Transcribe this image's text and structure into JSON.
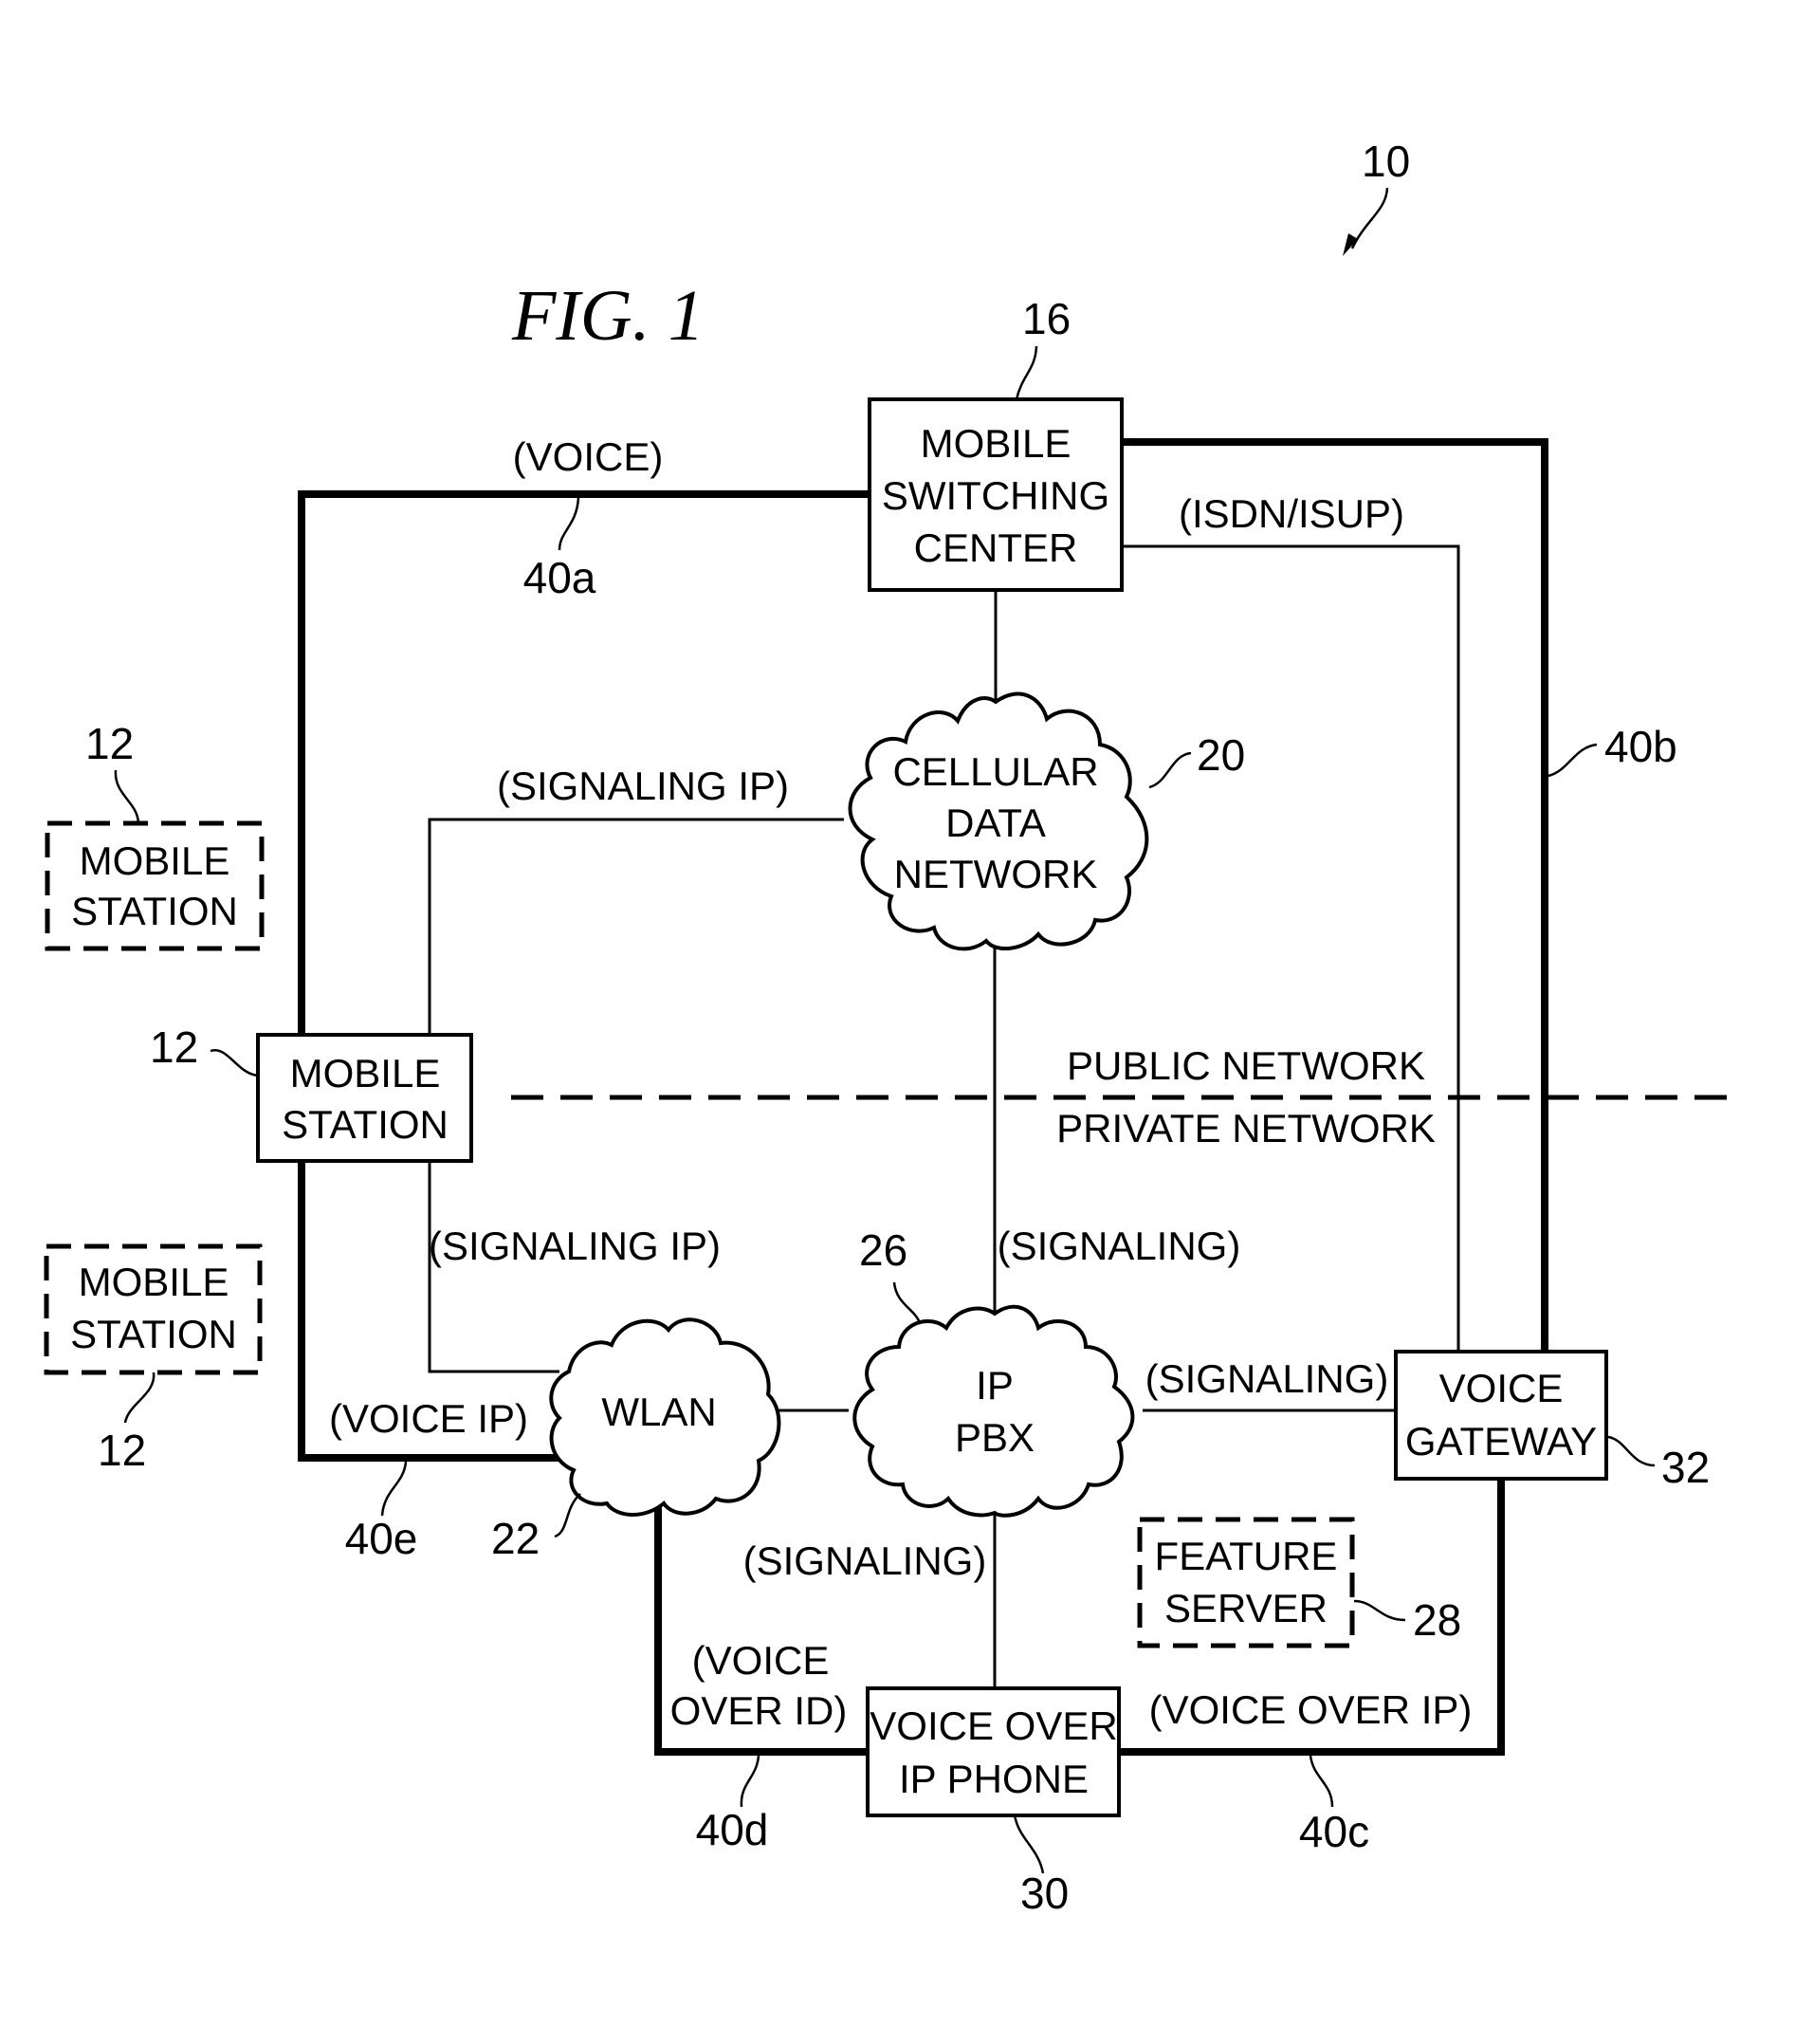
{
  "figure": {
    "title": "FIG. 1",
    "system_ref": "10"
  },
  "nodes": {
    "msc": {
      "ref": "16",
      "lines": [
        "MOBILE",
        "SWITCHING",
        "CENTER"
      ]
    },
    "cellular": {
      "ref": "20",
      "lines": [
        "CELLULAR",
        "DATA",
        "NETWORK"
      ]
    },
    "ms_main": {
      "ref": "12",
      "lines": [
        "MOBILE",
        "STATION"
      ]
    },
    "ms_upper": {
      "ref": "12",
      "lines": [
        "MOBILE",
        "STATION"
      ]
    },
    "ms_lower": {
      "ref": "12",
      "lines": [
        "MOBILE",
        "STATION"
      ]
    },
    "wlan": {
      "ref": "22",
      "lines": [
        "WLAN"
      ]
    },
    "ippbx": {
      "ref": "26",
      "lines": [
        "IP",
        "PBX"
      ]
    },
    "gateway": {
      "ref": "32",
      "lines": [
        "VOICE",
        "GATEWAY"
      ]
    },
    "feature": {
      "ref": "28",
      "lines": [
        "FEATURE",
        "SERVER"
      ]
    },
    "phone": {
      "ref": "30",
      "lines": [
        "VOICE OVER",
        "IP PHONE"
      ]
    }
  },
  "links": {
    "voice_a": {
      "label": "(VOICE)",
      "ref": "40a"
    },
    "voice_b": {
      "ref": "40b"
    },
    "voice_c": {
      "label": "(VOICE OVER IP)",
      "ref": "40c"
    },
    "voice_d": {
      "label_lines": [
        "(VOICE",
        "OVER ID)"
      ],
      "ref": "40d"
    },
    "voice_e": {
      "label": "(VOICE IP)",
      "ref": "40e"
    },
    "isdn": {
      "label": "(ISDN/ISUP)"
    },
    "sig_ip_upper": {
      "label": "(SIGNALING IP)"
    },
    "sig_ip_lower": {
      "label": "(SIGNALING IP)"
    },
    "sig_cell_pbx": {
      "label": "(SIGNALING)"
    },
    "sig_pbx_gw": {
      "label": "(SIGNALING)"
    },
    "sig_pbx_phone": {
      "label": "(SIGNALING)"
    }
  },
  "boundary": {
    "public": "PUBLIC NETWORK",
    "private": "PRIVATE NETWORK"
  }
}
